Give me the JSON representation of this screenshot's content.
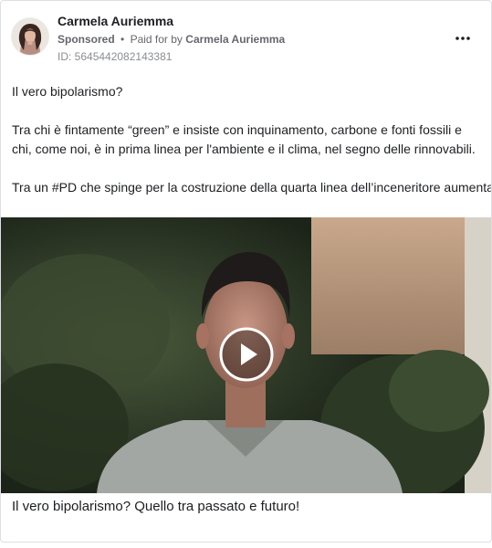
{
  "post": {
    "author": "Carmela Auriemma",
    "sponsored_label": "Sponsored",
    "separator": "•",
    "paid_for_prefix": "Paid for by",
    "payer": "Carmela Auriemma",
    "ad_id": "ID: 5645442082143381",
    "more_icon": "more-horizontal-icon",
    "paragraphs": [
      "Il vero bipolarismo?",
      "Tra chi è fintamente “green” e insiste con inquinamento, carbone e fonti fossili e chi, come noi, è in prima linea per l'ambiente e il clima, nel segno delle rinnovabili.",
      "Tra un #PD che spinge per la costruzione della quarta linea dell’inceneritore aumentando l’impatto ambientale sul nostro territorio o una “destra” che parla di…"
    ],
    "video": {
      "play_icon": "play-icon"
    },
    "caption": "Il vero bipolarismo? Quello tra passato e futuro!"
  },
  "colors": {
    "primary_text": "#1c1e21",
    "secondary_text": "#65676b",
    "muted_text": "#8a8d91",
    "border": "#dddfe2"
  }
}
